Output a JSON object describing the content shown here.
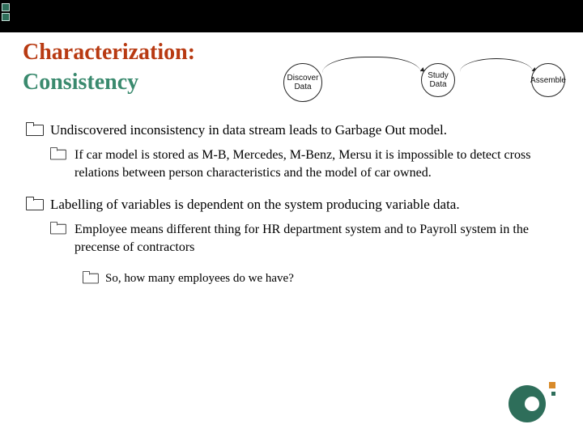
{
  "title": {
    "line1": "Characterization:",
    "line2": "Consistency"
  },
  "flow": {
    "nodes": [
      "Discover Data",
      "Study Data",
      "Assemble"
    ]
  },
  "bullets": {
    "b1": "Undiscovered inconsistency in data stream leads to Garbage Out model.",
    "b1_1": "If car model is stored as M-B, Mercedes, M-Benz, Mersu it is impossible to detect cross relations between person characteristics and the model of car owned.",
    "b2": "Labelling of variables is dependent on the system producing variable data.",
    "b2_1": "Employee means different thing for HR department system and to Payroll system in the precense of contractors",
    "b2_1_1": "So, how many employees do we have?"
  }
}
